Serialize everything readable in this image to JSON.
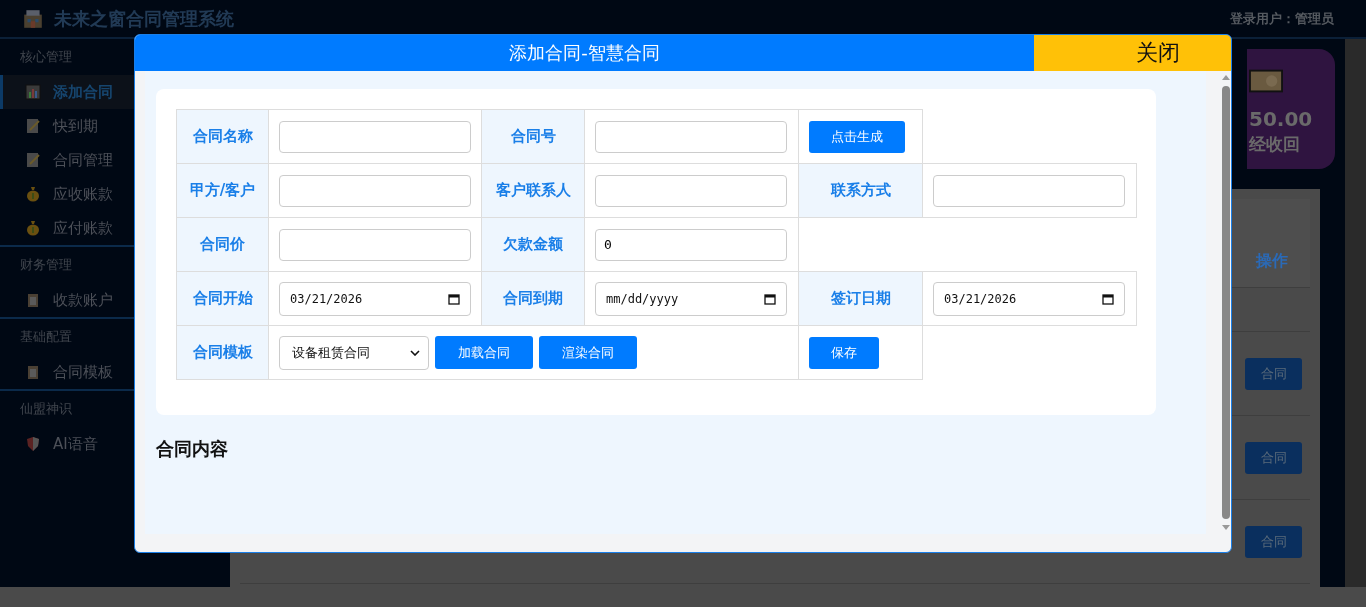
{
  "header": {
    "title": "未来之窗合同管理系统",
    "user": "登录用户：管理员"
  },
  "sidebar": {
    "groups": [
      {
        "title": "核心管理",
        "items": [
          {
            "label": "添加合同",
            "kind": "chart",
            "selected": true
          },
          {
            "label": "快到期",
            "kind": "note",
            "selected": false
          },
          {
            "label": "合同管理",
            "kind": "note",
            "selected": false
          },
          {
            "label": "应收账款",
            "kind": "moneybag",
            "selected": false
          },
          {
            "label": "应付账款",
            "kind": "moneybag",
            "selected": false
          }
        ]
      },
      {
        "title": "财务管理",
        "items": [
          {
            "label": "收款账户",
            "kind": "clipboard",
            "selected": false
          }
        ]
      },
      {
        "title": "基础配置",
        "items": [
          {
            "label": "合同模板",
            "kind": "clipboard",
            "selected": false
          }
        ]
      },
      {
        "title": "仙盟神识",
        "items": [
          {
            "label": "AI语音",
            "kind": "shield",
            "selected": false
          }
        ]
      }
    ]
  },
  "stat_card": {
    "amount": "50.00",
    "label": "经收回"
  },
  "table": {
    "action_header": "操作",
    "row_buttons": [
      "合同",
      "合同",
      "合同"
    ]
  },
  "modal": {
    "title": "添加合同-智慧合同",
    "close": "关闭",
    "rows": [
      [
        {
          "kind": "label",
          "text": "合同名称"
        },
        {
          "kind": "input"
        },
        {
          "kind": "label",
          "text": "合同号"
        },
        {
          "kind": "input"
        },
        {
          "kind": "button",
          "text": "点击生成"
        }
      ],
      [
        {
          "kind": "label",
          "text": "甲方/客户"
        },
        {
          "kind": "input"
        },
        {
          "kind": "label",
          "text": "客户联系人"
        },
        {
          "kind": "input"
        },
        {
          "kind": "label",
          "text": "联系方式"
        },
        {
          "kind": "input"
        }
      ],
      [
        {
          "kind": "label",
          "text": "合同价"
        },
        {
          "kind": "input"
        },
        {
          "kind": "label",
          "text": "欠款金额"
        },
        {
          "kind": "input",
          "value": "0"
        }
      ],
      [
        {
          "kind": "label",
          "text": "合同开始"
        },
        {
          "kind": "date",
          "value": "03/21/2026"
        },
        {
          "kind": "label",
          "text": "合同到期"
        },
        {
          "kind": "date",
          "placeholder": "mm/dd/yyyy"
        },
        {
          "kind": "label",
          "text": "签订日期"
        },
        {
          "kind": "date",
          "value": "03/21/2026"
        }
      ],
      [
        {
          "kind": "label",
          "text": "合同模板"
        },
        {
          "kind": "template",
          "value": "设备租赁合同",
          "buttons": [
            "加载合同",
            "渲染合同"
          ]
        },
        "",
        "",
        {
          "kind": "button",
          "text": "保存"
        }
      ]
    ],
    "section_title": "合同内容"
  }
}
